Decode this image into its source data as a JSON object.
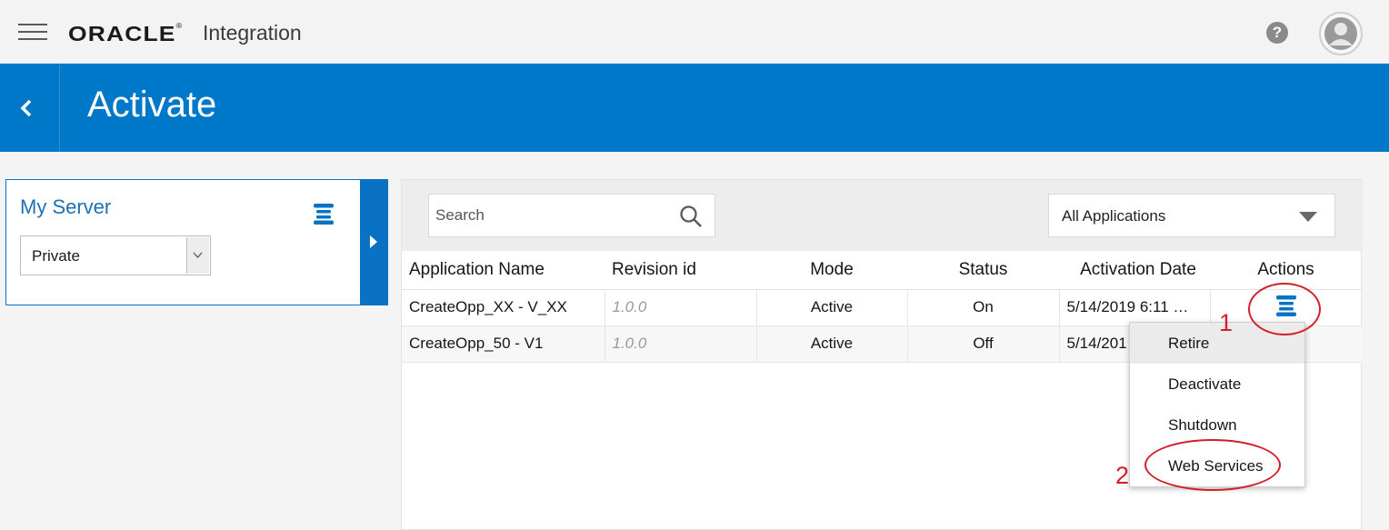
{
  "header": {
    "logo_text": "ORACLE",
    "logo_mark": "®",
    "product_name": "Integration",
    "help_label": "?"
  },
  "page": {
    "title": "Activate"
  },
  "server_panel": {
    "title": "My Server",
    "select_value": "Private"
  },
  "toolbar": {
    "search_placeholder": "Search",
    "filter_value": "All Applications"
  },
  "table": {
    "columns": [
      "Application Name",
      "Revision id",
      "Mode",
      "Status",
      "Activation Date",
      "Actions"
    ],
    "rows": [
      {
        "name": "CreateOpp_XX - V_XX",
        "revision": "1.0.0",
        "mode": "Active",
        "status": "On",
        "date": "5/14/2019 6:11 …"
      },
      {
        "name": "CreateOpp_50 - V1",
        "revision": "1.0.0",
        "mode": "Active",
        "status": "Off",
        "date": "5/14/201"
      }
    ]
  },
  "actions_menu": {
    "items": [
      "Retire",
      "Deactivate",
      "Shutdown",
      "Web Services"
    ]
  },
  "annotations": {
    "step1": "1",
    "step2": "2"
  },
  "colors": {
    "brand_blue": "#0078c9",
    "annotation_red": "#d21f2b"
  }
}
